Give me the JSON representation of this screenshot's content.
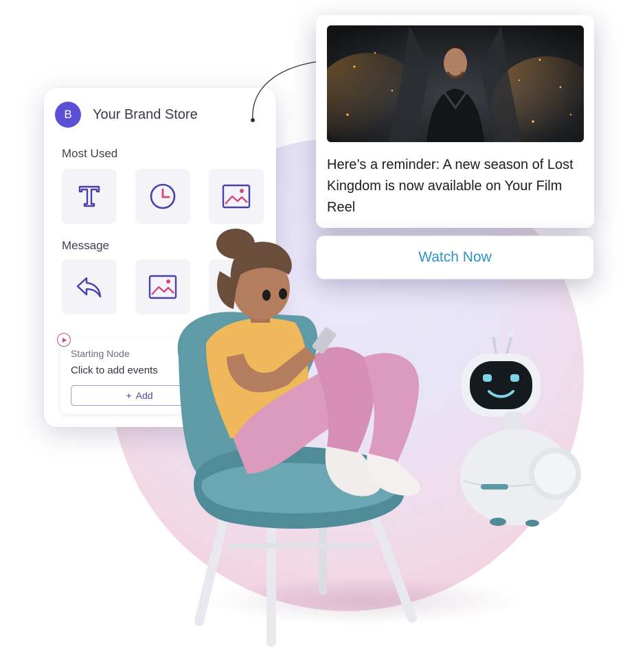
{
  "builder": {
    "avatar_letter": "B",
    "store_name": "Your Brand Store",
    "most_used_label": "Most Used",
    "message_label": "Message",
    "most_used_icons": [
      "text-icon",
      "clock-icon",
      "image-icon"
    ],
    "message_icons": [
      "reply-icon",
      "image-icon"
    ],
    "node": {
      "title": "Starting Node",
      "description": "Click to add events",
      "add_label": "Add",
      "add_icon": "plus-icon"
    }
  },
  "notification": {
    "text": "Here’s a reminder: A new season of Lost Kingdom is now available on Your Film Reel",
    "cta_label": "Watch Now"
  },
  "colors": {
    "accent": "#5a50d6",
    "icon_purple": "#4b3fae",
    "icon_pink": "#d1467c",
    "cta_blue": "#2f93c8",
    "chair_teal": "#5f9aa7",
    "shirt_yellow": "#efb85a",
    "pants_pink": "#dc9bbd"
  }
}
